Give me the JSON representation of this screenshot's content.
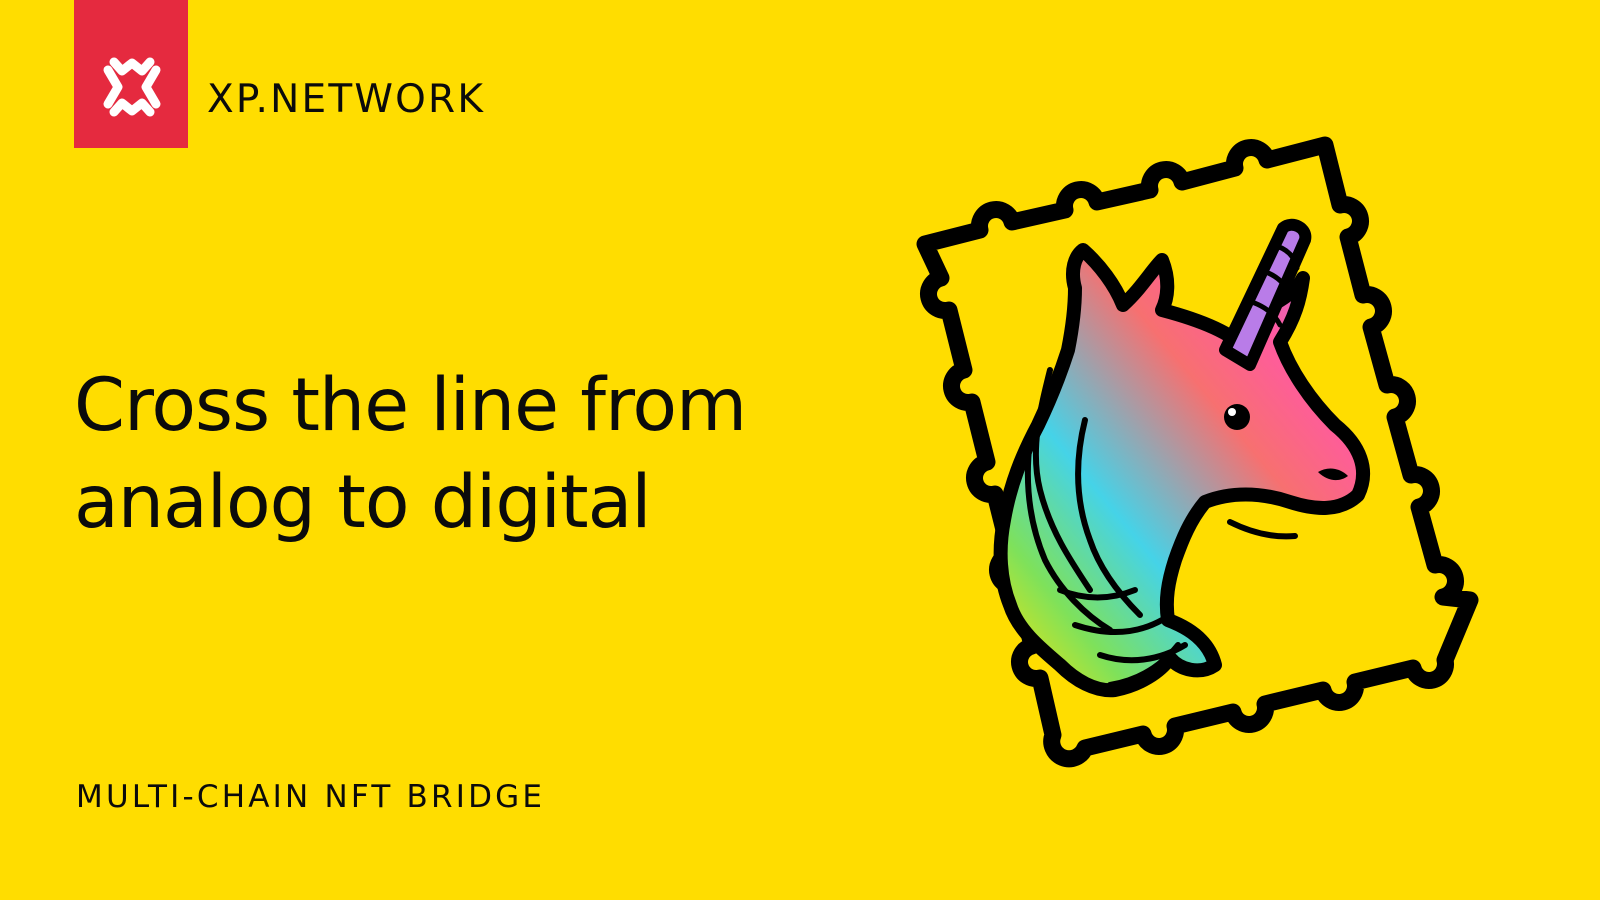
{
  "colors": {
    "background": "#FFDD00",
    "brand_red": "#E52A3F",
    "text": "#0B0B0B",
    "logo_mark": "#FFFFFF",
    "outline": "#000000"
  },
  "logo": {
    "icon": "xp-network-x-icon",
    "wordmark": "XP.NETWORK"
  },
  "headline": {
    "line1": "Cross the line from",
    "line2": "analog to digital"
  },
  "tagline": "MULTI-CHAIN NFT BRIDGE",
  "illustration": {
    "name": "unicorn-postage-stamp",
    "gradient_colors": [
      "#FFE600",
      "#7EE15B",
      "#45D3E8",
      "#F77070",
      "#FF5AA0",
      "#B97CE8"
    ]
  }
}
